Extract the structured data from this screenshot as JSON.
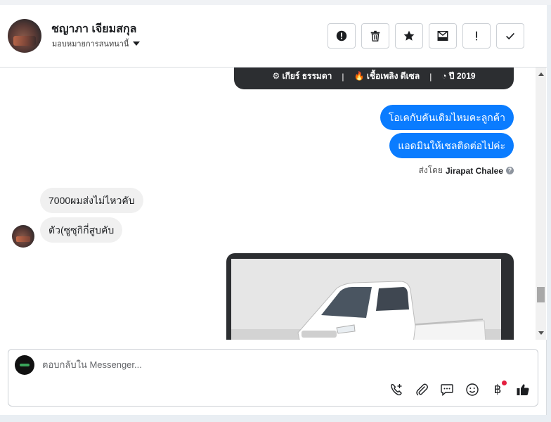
{
  "header": {
    "customer_name": "ชญาภา เจียมสกุล",
    "assign_label": "มอบหมายการสนทนานี้",
    "actions": [
      {
        "icon": "alert-circle-icon"
      },
      {
        "icon": "trash-icon"
      },
      {
        "icon": "star-icon"
      },
      {
        "icon": "mark-unread-icon"
      },
      {
        "icon": "spam-icon"
      },
      {
        "icon": "done-check-icon"
      }
    ]
  },
  "spec_card": {
    "gear": "⚙ เกียร์ ธรรมดา",
    "fuel": "🔥 เชื้อเพลิง ดีเซล",
    "year": "◔ ปี 2019",
    "separator": "|"
  },
  "messages": {
    "out_1": "โอเคกับคันเดิมไหมคะลูกค้า",
    "out_2": "แอดมินให้เชลติดต่อไปค่ะ",
    "sent_by_prefix": "ส่งโดย",
    "sent_by_name": "Jirapat Chalee",
    "in_1": "7000ผมส่งไม่ไหวคับ",
    "in_2": "ตัว(ซูซุกิกี่สูบคับ"
  },
  "composer": {
    "placeholder": "ตอบกลับใน Messenger...",
    "value": "",
    "baht_symbol": "฿",
    "tools": [
      "add-call-icon",
      "paperclip-icon",
      "saved-reply-icon",
      "emoji-icon",
      "baht-payment-icon",
      "thumbs-up-icon"
    ]
  },
  "colors": {
    "accent": "#0a7cff",
    "incoming_bubble": "#f0f0f0",
    "spec_card": "#2c2e31",
    "notification_dot": "#e41e3f"
  }
}
